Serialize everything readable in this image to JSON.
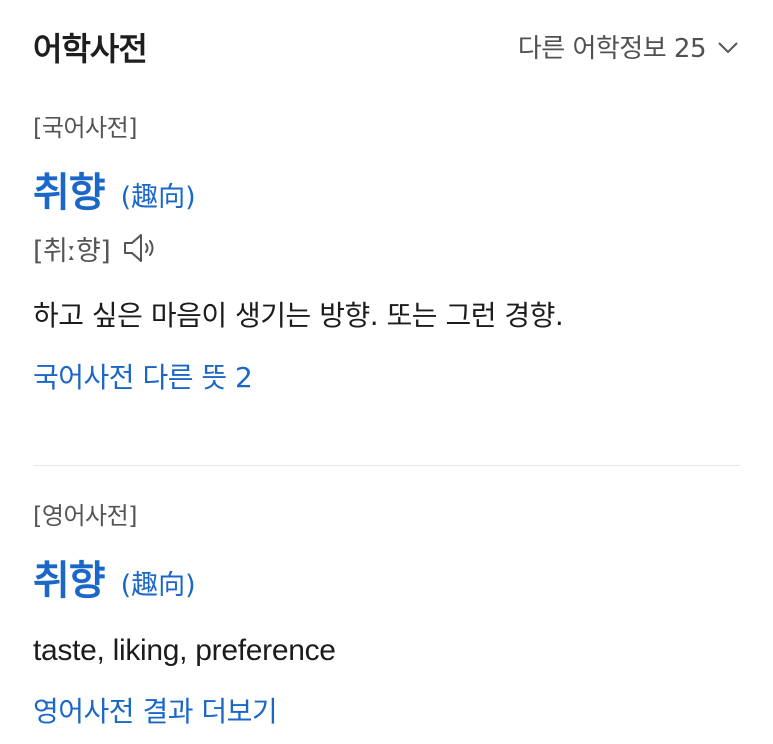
{
  "header": {
    "title": "어학사전",
    "more_label": "다른 어학정보 25"
  },
  "korean_dict": {
    "source": "[국어사전]",
    "headword": "취향",
    "hanja": "(趣向)",
    "pronunciation": "[취ː향]",
    "definition": "하고 싶은 마음이 생기는 방향. 또는 그런 경향.",
    "more_link": "국어사전 다른 뜻 2"
  },
  "english_dict": {
    "source": "[영어사전]",
    "headword": "취향",
    "hanja": "(趣向)",
    "translation": "taste, liking, preference",
    "more_link": "영어사전 결과 더보기"
  },
  "colors": {
    "link_blue": "#1a67c8",
    "divider": "#e6e6e6"
  },
  "icons": [
    "chevron-down-icon",
    "speaker-icon"
  ]
}
